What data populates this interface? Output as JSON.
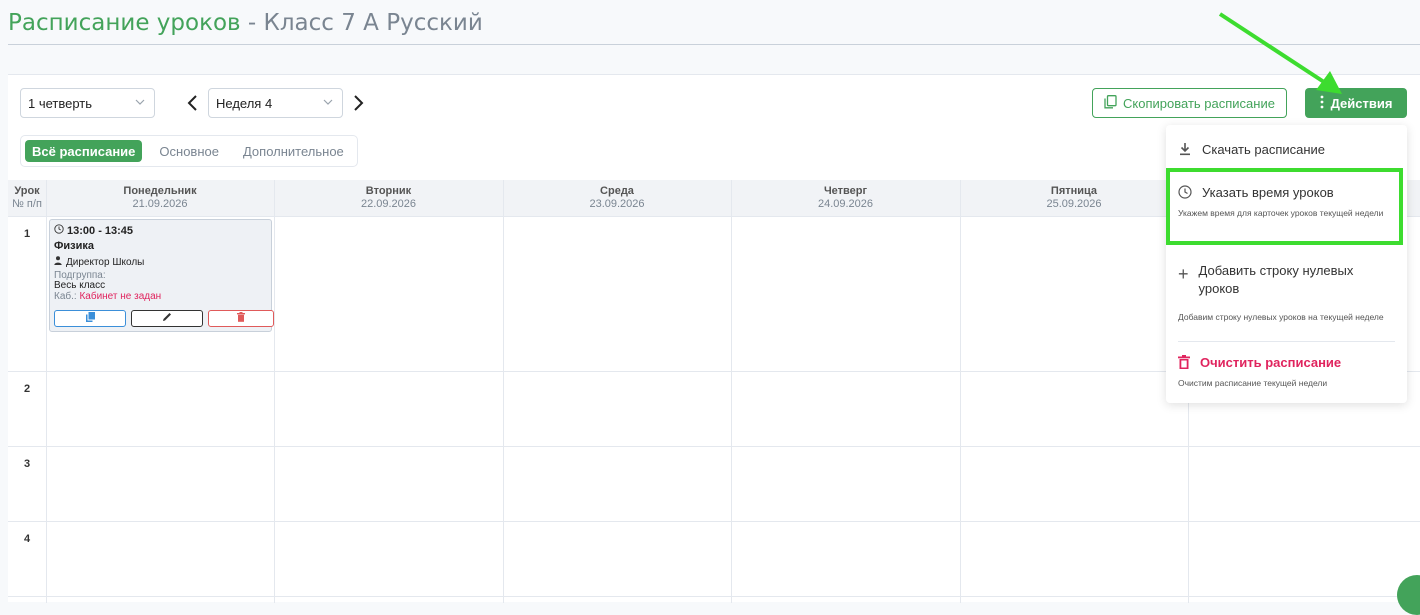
{
  "page": {
    "title_accent": "Расписание уроков",
    "title_sep": " - ",
    "title_rest": "Класс 7 А Русский"
  },
  "filters": {
    "quarter": "1 четверть",
    "week": "Неделя 4"
  },
  "actions": {
    "copy_label": "Скопировать расписание",
    "actions_label": "Действия"
  },
  "tabs": [
    {
      "label": "Всё расписание",
      "active": true
    },
    {
      "label": "Основное",
      "active": false
    },
    {
      "label": "Дополнительное",
      "active": false
    }
  ],
  "table": {
    "lesson_col": {
      "line1": "Урок",
      "line2": "№ п/п"
    },
    "days": [
      {
        "name": "Понедельник",
        "date": "21.09.2026"
      },
      {
        "name": "Вторник",
        "date": "22.09.2026"
      },
      {
        "name": "Среда",
        "date": "23.09.2026"
      },
      {
        "name": "Четверг",
        "date": "24.09.2026"
      },
      {
        "name": "Пятница",
        "date": "25.09.2026"
      }
    ],
    "rows": [
      "1",
      "2",
      "3",
      "4"
    ]
  },
  "lesson_card": {
    "time": "13:00 - 13:45",
    "subject": "Физика",
    "teacher": "Директор Школы",
    "subgroup_label": "Подгруппа:",
    "subgroup_value": "Весь класс",
    "room_label": "Каб.:",
    "room_value": "Кабинет не задан"
  },
  "menu": {
    "download": {
      "label": "Скачать расписание"
    },
    "set_time": {
      "label": "Указать время уроков",
      "desc": "Укажем время для карточек уроков текущей недели"
    },
    "add_row": {
      "label": "Добавить строку нулевых уроков",
      "desc": "Добавим строку нулевых уроков на текущей неделе"
    },
    "clear": {
      "label": "Очистить расписание",
      "desc": "Очистим расписание текущей недели"
    }
  },
  "colors": {
    "accent": "#43a35a",
    "danger": "#e0245e",
    "highlight": "#3ddc2f"
  }
}
